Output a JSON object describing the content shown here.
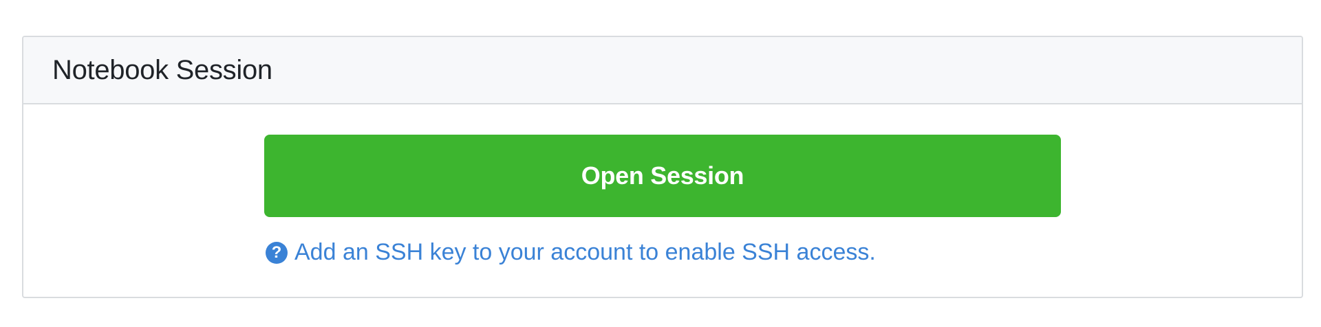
{
  "panel": {
    "title": "Notebook Session"
  },
  "actions": {
    "open_label": "Open Session"
  },
  "help": {
    "icon": "question-circle-icon",
    "text": "Add an SSH key to your account to enable SSH access."
  },
  "colors": {
    "primary_button": "#3db52f",
    "link": "#3a82d6",
    "header_bg": "#f7f8fa",
    "border": "#d9dcdf"
  }
}
